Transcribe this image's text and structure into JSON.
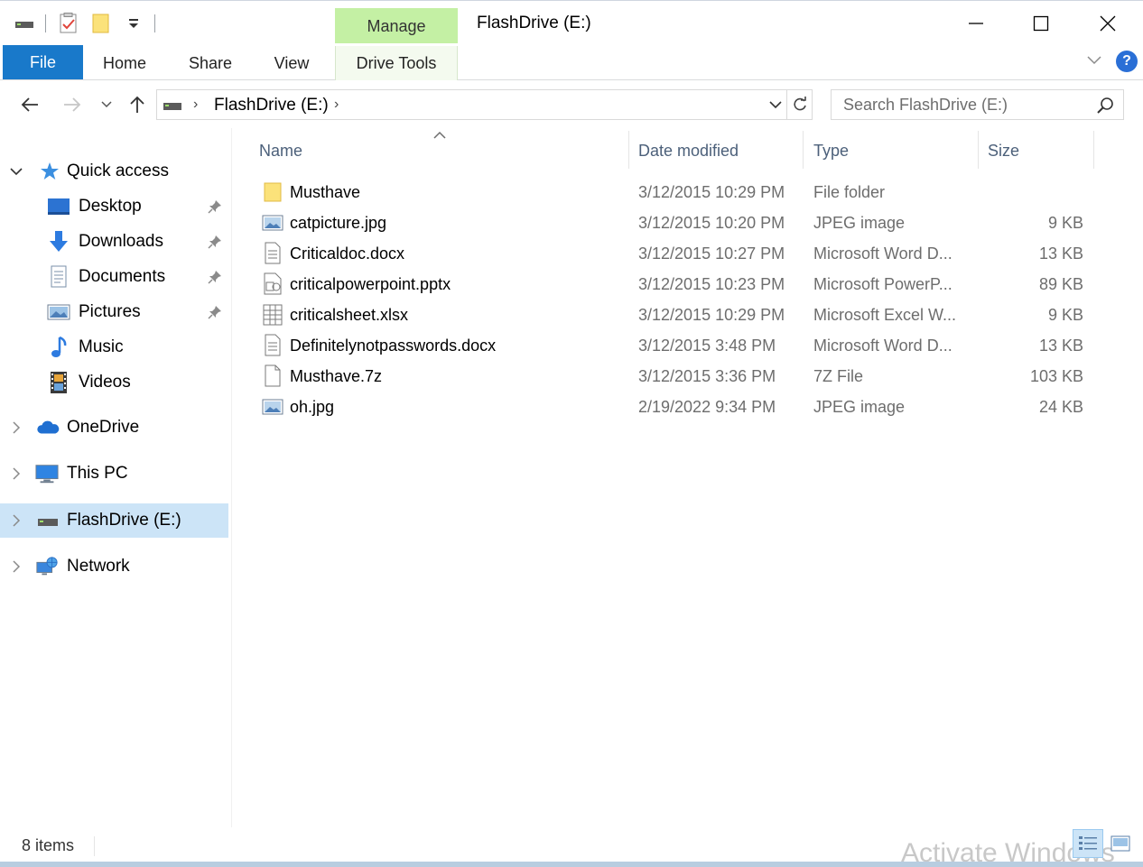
{
  "window": {
    "title": "FlashDrive (E:)",
    "context_tab_group": "Manage"
  },
  "ribbon": {
    "tabs": [
      {
        "label": "File"
      },
      {
        "label": "Home"
      },
      {
        "label": "Share"
      },
      {
        "label": "View"
      },
      {
        "label": "Drive Tools"
      }
    ]
  },
  "address": {
    "path": "FlashDrive (E:)",
    "search_placeholder": "Search FlashDrive (E:)"
  },
  "nav": {
    "quick_access": "Quick access",
    "pinned": [
      {
        "label": "Desktop",
        "icon": "desktop-icon",
        "pinned": true
      },
      {
        "label": "Downloads",
        "icon": "download-arrow-icon",
        "pinned": true
      },
      {
        "label": "Documents",
        "icon": "documents-icon",
        "pinned": true
      },
      {
        "label": "Pictures",
        "icon": "pictures-icon",
        "pinned": true
      },
      {
        "label": "Music",
        "icon": "music-note-icon",
        "pinned": false
      },
      {
        "label": "Videos",
        "icon": "film-icon",
        "pinned": false
      }
    ],
    "roots": [
      {
        "label": "OneDrive",
        "icon": "cloud-icon"
      },
      {
        "label": "This PC",
        "icon": "monitor-icon"
      },
      {
        "label": "FlashDrive (E:)",
        "icon": "drive-icon",
        "selected": true
      },
      {
        "label": "Network",
        "icon": "network-icon"
      }
    ]
  },
  "columns": {
    "name": "Name",
    "date": "Date modified",
    "type": "Type",
    "size": "Size"
  },
  "files": [
    {
      "name": "Musthave",
      "date": "3/12/2015 10:29 PM",
      "type": "File folder",
      "size": "",
      "icon": "folder-icon"
    },
    {
      "name": "catpicture.jpg",
      "date": "3/12/2015 10:20 PM",
      "type": "JPEG image",
      "size": "9 KB",
      "icon": "image-file-icon"
    },
    {
      "name": "Criticaldoc.docx",
      "date": "3/12/2015 10:27 PM",
      "type": "Microsoft Word D...",
      "size": "13 KB",
      "icon": "document-file-icon"
    },
    {
      "name": "criticalpowerpoint.pptx",
      "date": "3/12/2015 10:23 PM",
      "type": "Microsoft PowerP...",
      "size": "89 KB",
      "icon": "presentation-file-icon"
    },
    {
      "name": "criticalsheet.xlsx",
      "date": "3/12/2015 10:29 PM",
      "type": "Microsoft Excel W...",
      "size": "9 KB",
      "icon": "spreadsheet-file-icon"
    },
    {
      "name": "Definitelynotpasswords.docx",
      "date": "3/12/2015 3:48 PM",
      "type": "Microsoft Word D...",
      "size": "13 KB",
      "icon": "document-file-icon"
    },
    {
      "name": "Musthave.7z",
      "date": "3/12/2015 3:36 PM",
      "type": "7Z File",
      "size": "103 KB",
      "icon": "blank-file-icon"
    },
    {
      "name": "oh.jpg",
      "date": "2/19/2022 9:34 PM",
      "type": "JPEG image",
      "size": "24 KB",
      "icon": "image-file-icon"
    }
  ],
  "status": {
    "item_count": "8 items",
    "watermark": "Activate Windows"
  },
  "colors": {
    "file_tab": "#1979ca",
    "manage_tab": "#c4f0a4",
    "selection": "#cce4f7",
    "header_text": "#4c607a"
  }
}
